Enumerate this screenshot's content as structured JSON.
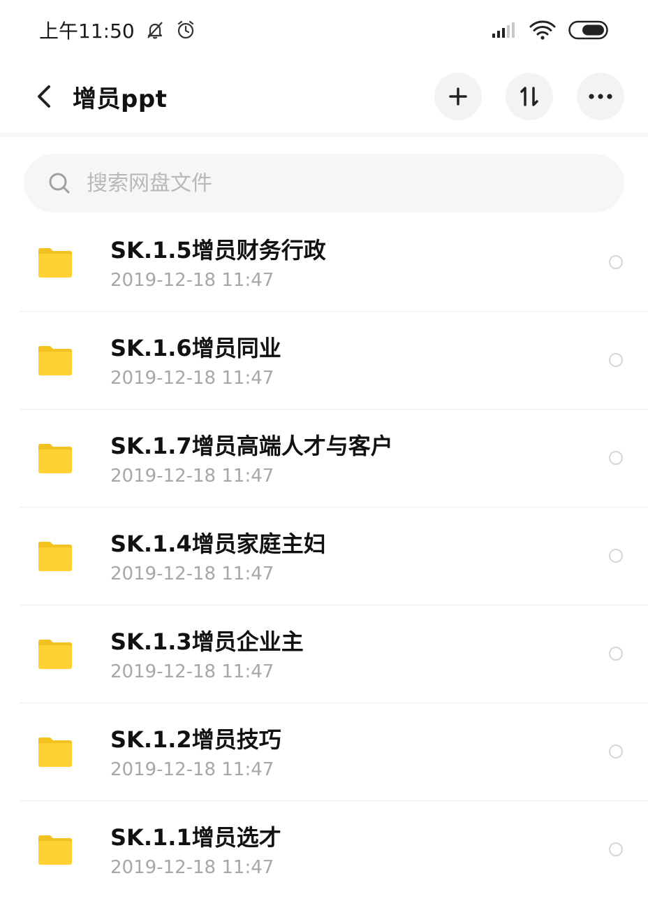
{
  "status_bar": {
    "time": "上午11:50",
    "icons": [
      "bell-off-icon",
      "alarm-clock-icon",
      "signal-icon",
      "wifi-icon",
      "battery-icon"
    ]
  },
  "header": {
    "title": "增员ppt",
    "actions": [
      "back-icon",
      "add-icon",
      "sort-icon",
      "more-icon"
    ]
  },
  "search": {
    "placeholder": "搜索网盘文件"
  },
  "files": [
    {
      "name": "SK.1.5增员财务行政",
      "date": "2019-12-18  11:47"
    },
    {
      "name": "SK.1.6增员同业",
      "date": "2019-12-18  11:47"
    },
    {
      "name": "SK.1.7增员高端人才与客户",
      "date": "2019-12-18  11:47"
    },
    {
      "name": "SK.1.4增员家庭主妇",
      "date": "2019-12-18  11:47"
    },
    {
      "name": "SK.1.3增员企业主",
      "date": "2019-12-18  11:47"
    },
    {
      "name": "SK.1.2增员技巧",
      "date": "2019-12-18  11:47"
    },
    {
      "name": "SK.1.1增员选才",
      "date": "2019-12-18  11:47"
    }
  ],
  "colors": {
    "folder": "#FFD233",
    "folder_tab": "#F4C21E",
    "secondary_text": "#A7A7AB",
    "search_bg": "#F6F6F7"
  }
}
